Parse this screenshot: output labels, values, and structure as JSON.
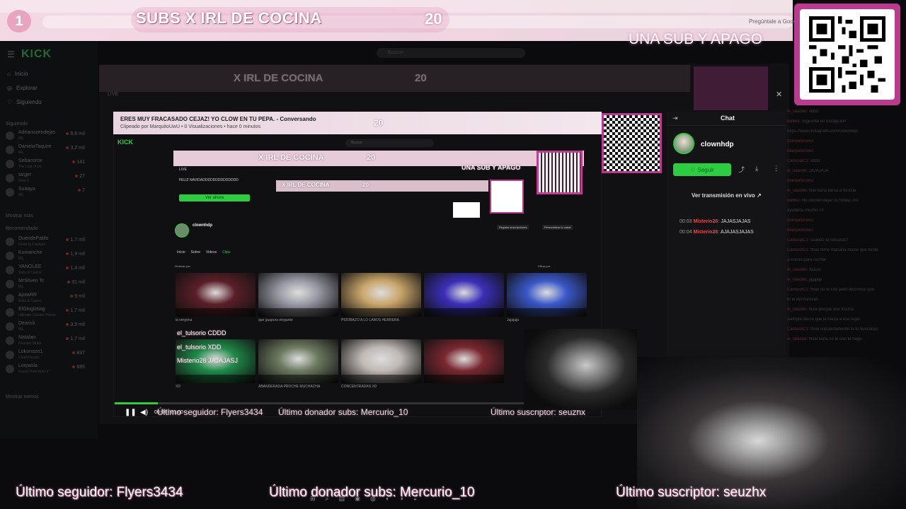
{
  "header": {
    "step_number": "1",
    "banner_title": "SUBS X IRL DE COCINA",
    "banner_count": "20",
    "tagline": "UNA SUB Y APAGO",
    "ask_google": "Pregúntale a Google"
  },
  "sidebar": {
    "logo": "KICK",
    "nav": [
      {
        "label": "Inicio",
        "icon": "home-icon"
      },
      {
        "label": "Explorar",
        "icon": "compass-icon"
      },
      {
        "label": "Siguiendo",
        "icon": "heart-icon"
      }
    ],
    "following_title": "Siguiendo",
    "following": [
      {
        "name": "Adrianozendejas",
        "sub": "IRL",
        "viewers": "8,6 mil"
      },
      {
        "name": "DanielaTaquire",
        "sub": "IRL",
        "viewers": "3,2 mil"
      },
      {
        "name": "Sebacorox",
        "sub": "The Last of Us",
        "viewers": "141"
      },
      {
        "name": "Iarger",
        "sub": "Dota 2",
        "viewers": "27"
      },
      {
        "name": "Suaaya",
        "sub": "IRL",
        "viewers": "7"
      }
    ],
    "show_more": "Mostrar más",
    "recommended_title": "Recomendado",
    "recommended": [
      {
        "name": "DuendePablo",
        "sub": "Dead by Daylight",
        "viewers": "1,7 mil"
      },
      {
        "name": "Komanche",
        "sub": "IRL",
        "viewers": "1,9 mil"
      },
      {
        "name": "YANOLEE",
        "sub": "Slots & Casino",
        "viewers": "1,4 mil"
      },
      {
        "name": "MrStiven Tc",
        "sub": "IRL",
        "viewers": "31 mil"
      },
      {
        "name": "AjotaRR",
        "sub": "Slots & Casino",
        "viewers": "9 mil"
      },
      {
        "name": "ElGloglotiag",
        "sub": "Ultimate Chicken Horse",
        "viewers": "1,7 mil"
      },
      {
        "name": "Dearick",
        "sub": "IRL",
        "viewers": "3,9 mil"
      },
      {
        "name": "Natalan",
        "sub": "Counter-Strike",
        "viewers": "1,7 mil"
      },
      {
        "name": "Lokonazo1",
        "sub": "Clash Royale",
        "viewers": "837"
      },
      {
        "name": "Lorpasla",
        "sub": "Grand Theft Auto V",
        "viewers": "695"
      }
    ],
    "show_more_2": "Mostrar menos"
  },
  "search": {
    "placeholder": "Buscar"
  },
  "capture": {
    "clip_title": "ERES MUY FRACASADO CEJAZ! YO CLOW EN TU PEPA. - Conversando",
    "clip_sub": "Clipeado por MarquitoUwU • 0 Visualizaciones • hace 0 minutos",
    "clip_count": "20",
    "inner_title": "X IRL DE COCINA",
    "inner_count": "20",
    "inner_tagline": "UNA SUB Y APAGO",
    "inner_title_2": "X IRL DE COCINA",
    "inner_count_2": "20",
    "live": "LIVE",
    "feliz": "FELIZ NAVIDADDDDDDDDDDDDDD",
    "ver_ahora": "Ver ahora",
    "channel": "clownhdp",
    "tabs": [
      "Inicio",
      "Sobre",
      "Videos",
      "Clips"
    ],
    "regalar": "Regalar suscripciones",
    "personalizar": "Personalizar tu canal",
    "ordenar": "Ordenar por:",
    "filtrar": "Filtrar por:",
    "overlay_1": "el_tulsorio CDDD",
    "overlay_2": "el_tulsorio XDD",
    "overlay_3": "Misterio28 JAJAJASJ",
    "thumbs": [
      {
        "title": "la vergona",
        "color": "#5a1f28"
      },
      {
        "title": "que guapura elegante",
        "color": "#9a9aa6"
      },
      {
        "title": "PIDOBAZO A LO LABOS HERRERA",
        "color": "#c9a56a"
      },
      {
        "title": "",
        "color": "#3b2fb8"
      },
      {
        "title": "Jajajaja",
        "color": "#3a58c8"
      },
      {
        "title": "XD",
        "color": "#1f8a4a"
      },
      {
        "title": "ABANDERADA PROCHE MUCHACHA",
        "color": "#6d7a60"
      },
      {
        "title": "CONCENTRADAS XD",
        "color": "#bfb9b5"
      },
      {
        "title": "",
        "color": "#7a2830"
      }
    ]
  },
  "chat": {
    "title": "Chat",
    "channel": "clownhdp",
    "follow": "Seguir",
    "watch_live": "Ver transmisión en vivo",
    "messages": [
      {
        "time": "00:03",
        "user": "Misterio28:",
        "text": "JAJASJAJAS"
      },
      {
        "time": "00:04",
        "user": "Misterio28:",
        "text": "AJAJASJAJAS"
      }
    ]
  },
  "bg_chat": [
    {
      "user": "el_lalaorio:",
      "text": "xddd"
    },
    {
      "user": "BotBlu:",
      "text": "Sígueme en Instagram!"
    },
    {
      "user": "",
      "text": "https://www.instagram.com/clownhdp/"
    },
    {
      "user": "MarquitoUwU:",
      "text": ""
    },
    {
      "user": "MarquitoUwU:",
      "text": ""
    },
    {
      "user": "CarlosGC1:",
      "text": "xddd"
    },
    {
      "user": "el_lalaorio:",
      "text": "JAJAJAJA"
    },
    {
      "user": "MarquitoUwU:",
      "text": ""
    },
    {
      "user": "el_lalaorio:",
      "text": "flow karla llama a mi lista"
    },
    {
      "user": "BotBlu:",
      "text": "No olviden dejar su follow, me"
    },
    {
      "user": "",
      "text": "ayudaría mucho <3"
    },
    {
      "user": "MarquitoUwU:",
      "text": ""
    },
    {
      "user": "MarquitoUwU:",
      "text": ""
    },
    {
      "user": "CarlosGC1:",
      "text": "cuando te retirarás?"
    },
    {
      "user": "CarlosGC1:",
      "text": "fflow firme mañana decile que fuiste"
    },
    {
      "user": "",
      "text": "a Ancón para cachar"
    },
    {
      "user": "el_lalaorio:",
      "text": "XDDD"
    },
    {
      "user": "el_lalaorio:",
      "text": "jajajaja"
    },
    {
      "user": "CarlosGC1:",
      "text": "fflow no le creí pero reconoce que"
    },
    {
      "user": "",
      "text": "tu la desmentías"
    },
    {
      "user": "el_lalaorio:",
      "text": "fflow porque ese mismo"
    },
    {
      "user": "",
      "text": "siempre decía que le hacía a ese lugar"
    },
    {
      "user": "CarlosGC1:",
      "text": "fflow supuestamente tu tu buscabas"
    },
    {
      "user": "el_lalaorio:",
      "text": "fflow karla no le creí te hago"
    }
  ],
  "player": {
    "time": "00:04 / 01:00",
    "progress": 0.09
  },
  "bottom": {
    "last_follower": "Último seguidor: Flyers3434",
    "last_donor": "Último donador subs: Mercurio_10",
    "last_sub": "Último suscriptor: seuzhx"
  },
  "mid_overlay": {
    "last_follower": "Último seguidor: Flyers3434",
    "last_donor": "Último donador subs: Mercurio_10",
    "last_sub": "Último suscriptor: seuzhx"
  },
  "colors": {
    "accent": "#2ecc40",
    "pink": "#e7cbd8",
    "qr_border": "#b93a8f"
  }
}
